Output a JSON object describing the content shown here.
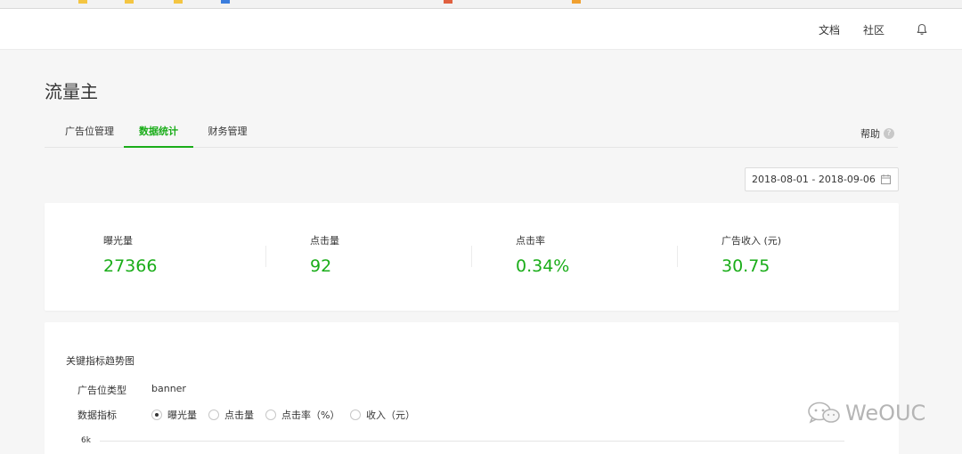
{
  "topbar": {
    "docs": "文档",
    "community": "社区"
  },
  "page": {
    "title": "流量主"
  },
  "tabs": [
    {
      "label": "广告位管理",
      "active": false
    },
    {
      "label": "数据统计",
      "active": true
    },
    {
      "label": "财务管理",
      "active": false
    }
  ],
  "help": {
    "label": "帮助",
    "icon": "question-circle-icon"
  },
  "date_range": {
    "value": "2018-08-01 - 2018-09-06",
    "icon": "calendar-icon"
  },
  "stats": [
    {
      "label": "曝光量",
      "value": "27366"
    },
    {
      "label": "点击量",
      "value": "92"
    },
    {
      "label": "点击率",
      "value": "0.34%"
    },
    {
      "label": "广告收入 (元)",
      "value": "30.75"
    }
  ],
  "trend": {
    "title": "关键指标趋势图",
    "ad_type_label": "广告位类型",
    "ad_type_value": "banner",
    "metric_label": "数据指标",
    "metrics": [
      {
        "label": "曝光量",
        "checked": true
      },
      {
        "label": "点击量",
        "checked": false
      },
      {
        "label": "点击率（%）",
        "checked": false
      },
      {
        "label": "收入（元）",
        "checked": false
      }
    ],
    "y_tick": "6k"
  },
  "watermark": {
    "text": "WeOUC"
  },
  "colors": {
    "accent": "#1aad19",
    "text": "#353535",
    "background": "#f6f6f6"
  }
}
